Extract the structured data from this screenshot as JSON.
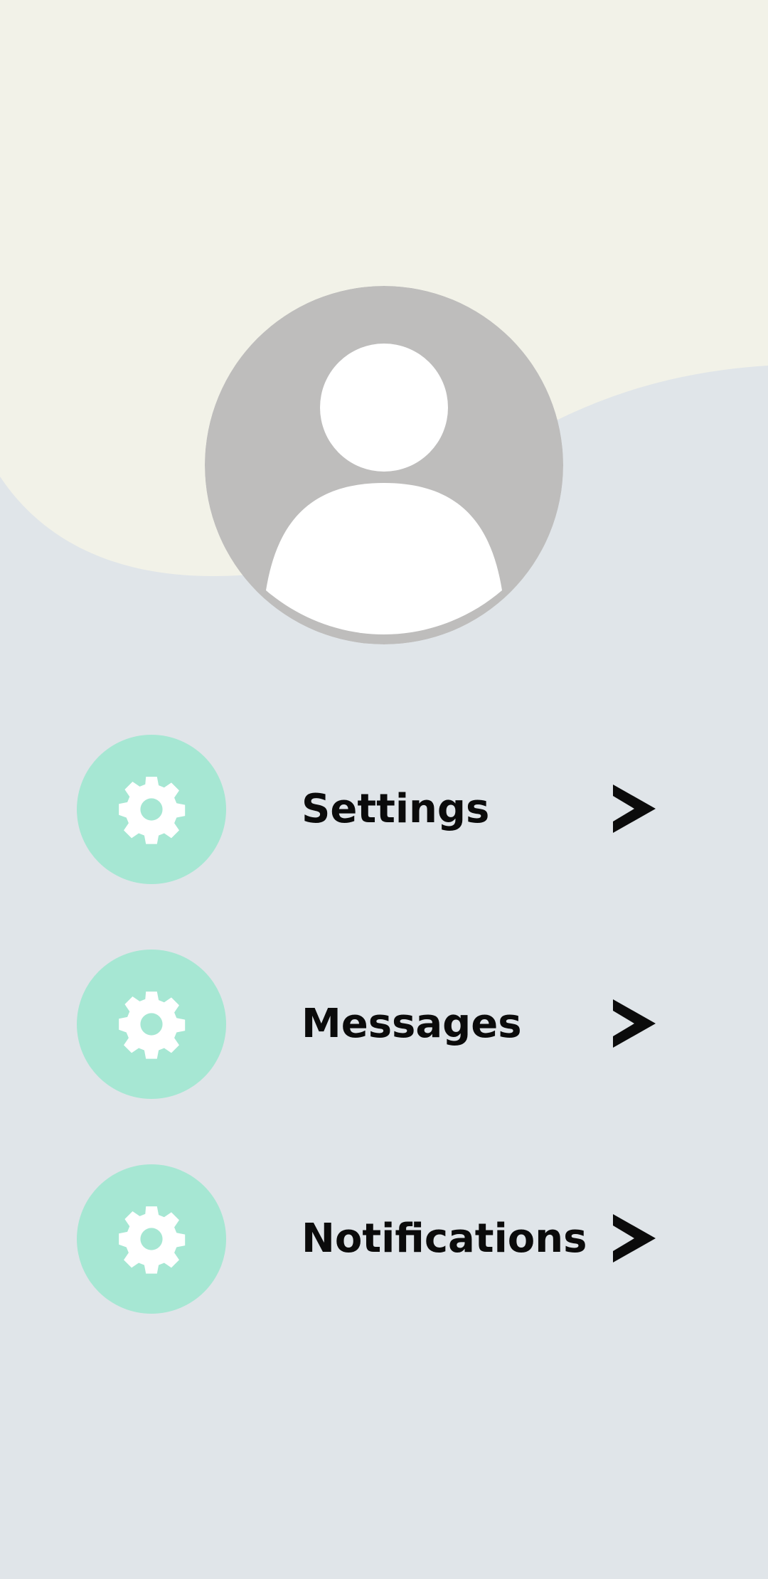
{
  "theme": {
    "background": "#e0e5e9",
    "wave": "#f2f2e8",
    "avatar_bg": "#bebdbc",
    "avatar_figure": "#ffffff",
    "icon_bg": "#a6e7d3",
    "icon_fg": "#ffffff",
    "text": "#0b0b0b",
    "chevron": "#0b0b0b"
  },
  "profile": {
    "avatar_icon": "user-avatar-icon"
  },
  "menu": {
    "items": [
      {
        "label": "Settings",
        "icon": "gear-icon",
        "chevron": "chevron-right-icon"
      },
      {
        "label": "Messages",
        "icon": "gear-icon",
        "chevron": "chevron-right-icon"
      },
      {
        "label": "Notifications",
        "icon": "gear-icon",
        "chevron": "chevron-right-icon"
      }
    ]
  }
}
